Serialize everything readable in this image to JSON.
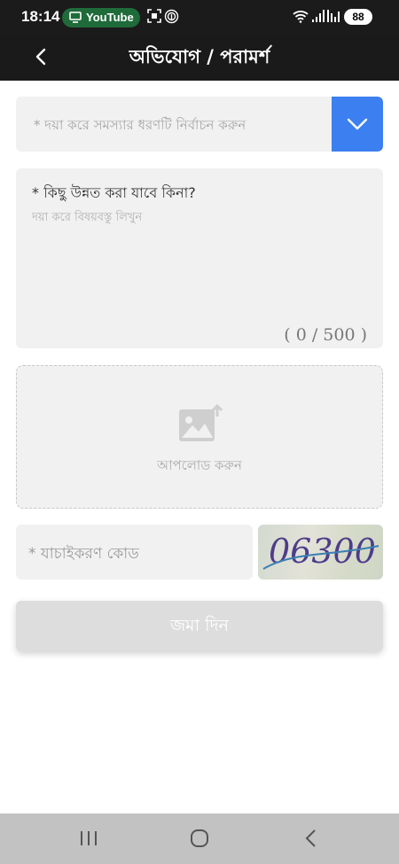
{
  "status_bar": {
    "time": "18:14",
    "app_pill_label": "YouTube",
    "battery": "88"
  },
  "app_bar": {
    "title": "অভিযোগ / পরামর্শ"
  },
  "form": {
    "category_placeholder": "* দয়া করে সমস্যার ধরণটি নির্বাচন করুন",
    "details_label": "* কিছু উন্নত করা যাবে কিনা?",
    "details_placeholder": "দয়া করে বিষয়বস্তু লিখুন",
    "char_counter": "( 0 / 500 )",
    "upload_label": "আপলোড করুন",
    "captcha_placeholder": "* যাচাইকরণ কোড",
    "captcha_code": "06300",
    "submit_label": "জমা দিন"
  },
  "colors": {
    "accent": "#3c7ff0",
    "header_bg": "#1a1a1a",
    "field_bg": "#f1f1f1"
  }
}
